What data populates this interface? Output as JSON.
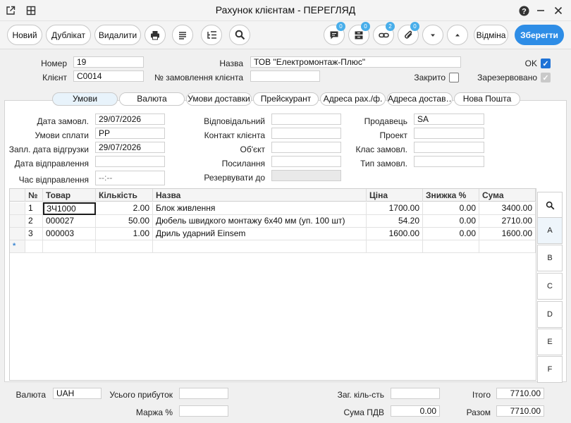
{
  "window": {
    "title": "Рахунок клієнтам - ПЕРЕГЛЯД"
  },
  "toolbar": {
    "new": "Новий",
    "duplicate": "Дублікат",
    "delete": "Видалити",
    "comments_count": "0",
    "attachments_count": "0",
    "links_count": "2",
    "files_count": "0",
    "cancel": "Відміна",
    "save": "Зберегти"
  },
  "header": {
    "number_label": "Номер",
    "number": "19",
    "client_label": "Клієнт",
    "client": "С0014",
    "name_label": "Назва",
    "name": "ТОВ \"Електромонтаж-Плюс\"",
    "order_label": "№ замовлення клієнта",
    "order": "",
    "ok_label": "OK",
    "closed_label": "Закрито",
    "reserved_label": "Зарезервовано"
  },
  "tabs": [
    "Умови",
    "Валюта",
    "Умови доставки",
    "Прейскурант",
    "Адреса рах./ф.",
    "Адреса достав…",
    "Нова Пошта"
  ],
  "conditions": {
    "order_date_label": "Дата замовл.",
    "order_date": "29/07/2026",
    "payment_label": "Умови сплати",
    "payment": "РР",
    "ship_plan_label": "Запл. дата відгрузки",
    "ship_plan": "29/07/2026",
    "ship_date_label": "Дата відправлення",
    "ship_date": "",
    "ship_time_label": "Час відправлення",
    "ship_time": "--:--",
    "responsible_label": "Відповідальний",
    "responsible": "",
    "contact_label": "Контакт клієнта",
    "contact": "",
    "object_label": "Об'єкт",
    "object": "",
    "reference_label": "Посилання",
    "reference": "",
    "reserve_until_label": "Резервувати до",
    "reserve_until": "",
    "seller_label": "Продавець",
    "seller": "SA",
    "project_label": "Проект",
    "project": "",
    "order_class_label": "Клас замовл.",
    "order_class": "",
    "order_type_label": "Тип замовл.",
    "order_type": ""
  },
  "grid": {
    "columns": [
      "№",
      "Товар",
      "Кількість",
      "Назва",
      "Ціна",
      "Знижка %",
      "Сума"
    ],
    "rows": [
      {
        "n": "1",
        "item": "ЗЧ1000",
        "qty": "2.00",
        "name": "Блок живлення",
        "price": "1700.00",
        "discount": "0.00",
        "sum": "3400.00"
      },
      {
        "n": "2",
        "item": "000027",
        "qty": "50.00",
        "name": "Дюбель швидкого монтажу 6х40 мм (уп. 100 шт)",
        "price": "54.20",
        "discount": "0.00",
        "sum": "2710.00"
      },
      {
        "n": "3",
        "item": "000003",
        "qty": "1.00",
        "name": "Дриль ударний Einsem",
        "price": "1600.00",
        "discount": "0.00",
        "sum": "1600.00"
      }
    ],
    "new_row_marker": "*"
  },
  "side_letters": [
    "A",
    "B",
    "C",
    "D",
    "E",
    "F"
  ],
  "footer": {
    "currency_label": "Валюта",
    "currency": "UAH",
    "profit_label": "Усього прибуток",
    "profit": "",
    "margin_label": "Маржа %",
    "margin": "",
    "total_qty_label": "Заг. кіль-сть",
    "total_qty": "",
    "vat_label": "Сума ПДВ",
    "vat": "0.00",
    "subtotal_label": "Ітого",
    "subtotal": "7710.00",
    "total_label": "Разом",
    "total": "7710.00"
  },
  "colors": {
    "accent": "#2e8de6",
    "badge": "#48aeea",
    "checkbox": "#1f73d6"
  }
}
